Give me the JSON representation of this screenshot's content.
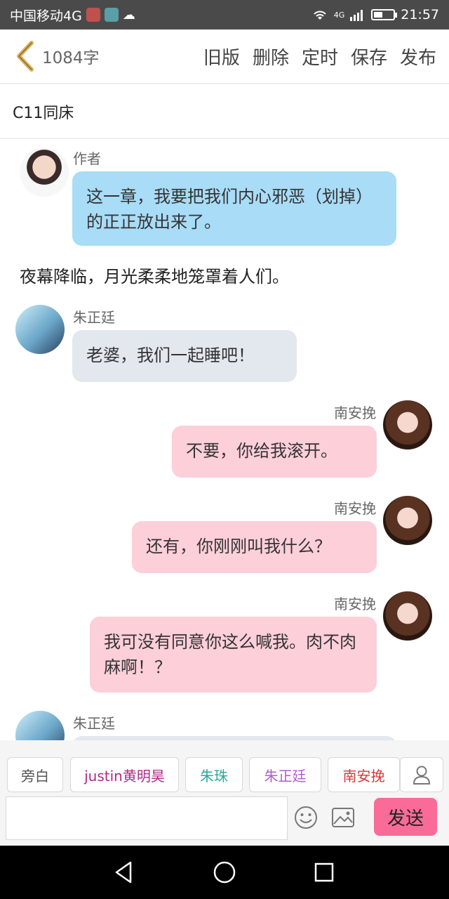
{
  "status_bar": {
    "carrier": "中国移动4G",
    "network": "4G",
    "time": "21:57"
  },
  "header": {
    "word_count": "1084字",
    "actions": [
      "旧版",
      "删除",
      "定时",
      "保存",
      "发布"
    ]
  },
  "chapter_title": "C11同床",
  "messages": [
    {
      "type": "left",
      "speaker": "作者",
      "text": "这一章，我要把我们内心邪恶（划掉）的正正放出来了。",
      "color": "blue"
    },
    {
      "type": "narration",
      "text": "夜幕降临，月光柔柔地笼罩着人们。"
    },
    {
      "type": "left",
      "speaker": "朱正廷",
      "text": "老婆，我们一起睡吧！",
      "color": "gray"
    },
    {
      "type": "right",
      "speaker": "南安挽",
      "text": "不要，你给我滚开。",
      "color": "pink"
    },
    {
      "type": "right",
      "speaker": "南安挽",
      "text": "还有，你刚刚叫我什么？",
      "color": "pink"
    },
    {
      "type": "right",
      "speaker": "南安挽",
      "text": "我可没有同意你这么喊我。肉不肉麻啊！？",
      "color": "pink"
    },
    {
      "type": "left",
      "speaker": "朱正廷",
      "text": "",
      "color": "gray"
    }
  ],
  "characters": [
    {
      "label": "旁白",
      "color": "#555555"
    },
    {
      "label": "justin黄明昊",
      "color": "#b0298a"
    },
    {
      "label": "朱珠",
      "color": "#2aa89a"
    },
    {
      "label": "朱正廷",
      "color": "#b35bd1"
    },
    {
      "label": "南安挽",
      "color": "#d8353a"
    }
  ],
  "input": {
    "placeholder": "",
    "send_label": "发送"
  },
  "colors": {
    "accent": "#fa6b9a",
    "back_chevron": "#e0b25a",
    "author_bubble": "#a8dcf7",
    "male_bubble": "#e3e7ee",
    "female_bubble": "#fccfd9"
  }
}
